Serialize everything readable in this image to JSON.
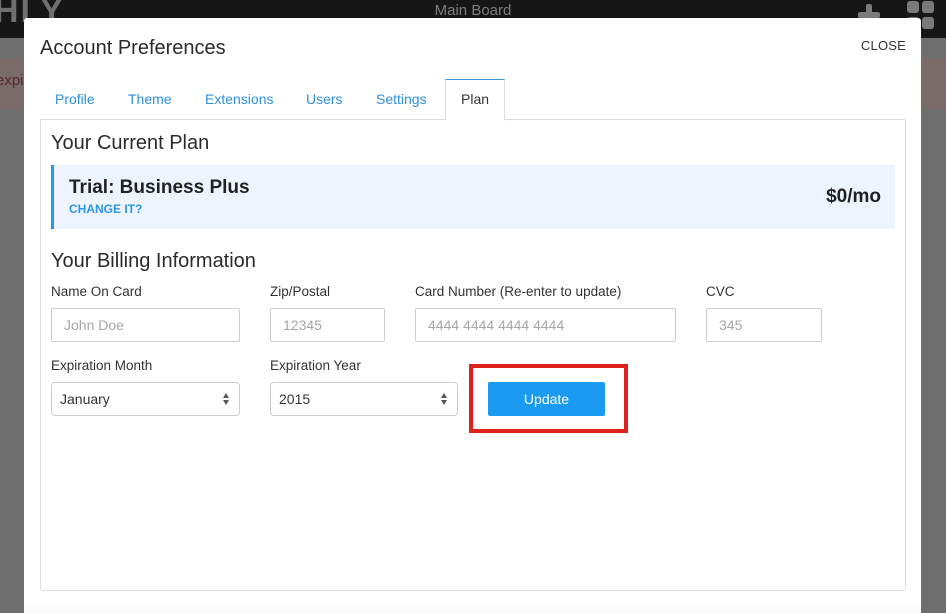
{
  "background_app": {
    "logo_text": "HLY",
    "board_title": "Main Board",
    "alert_text": "expi",
    "icons": [
      "plus-icon",
      "grid-icon"
    ]
  },
  "modal": {
    "title": "Account Preferences",
    "close_label": "CLOSE",
    "tabs": [
      {
        "label": "Profile",
        "active": false
      },
      {
        "label": "Theme",
        "active": false
      },
      {
        "label": "Extensions",
        "active": false
      },
      {
        "label": "Users",
        "active": false
      },
      {
        "label": "Settings",
        "active": false
      },
      {
        "label": "Plan",
        "active": true
      }
    ]
  },
  "current_plan": {
    "heading": "Your Current Plan",
    "plan_name": "Trial: Business Plus",
    "change_link": "CHANGE IT?",
    "price": "$0/mo"
  },
  "billing": {
    "heading": "Your Billing Information",
    "fields": {
      "name_on_card": {
        "label": "Name On Card",
        "value": "",
        "placeholder": "John Doe"
      },
      "zip": {
        "label": "Zip/Postal",
        "value": "",
        "placeholder": "12345"
      },
      "card_number": {
        "label": "Card Number (Re-enter to update)",
        "value": "",
        "placeholder": "4444 4444 4444 4444"
      },
      "cvc": {
        "label": "CVC",
        "value": "",
        "placeholder": "345"
      },
      "exp_month": {
        "label": "Expiration Month",
        "selected": "January"
      },
      "exp_year": {
        "label": "Expiration Year",
        "selected": "2015"
      }
    },
    "update_label": "Update"
  },
  "annotation": {
    "highlight_color": "#e0201b",
    "target": "update-button"
  }
}
